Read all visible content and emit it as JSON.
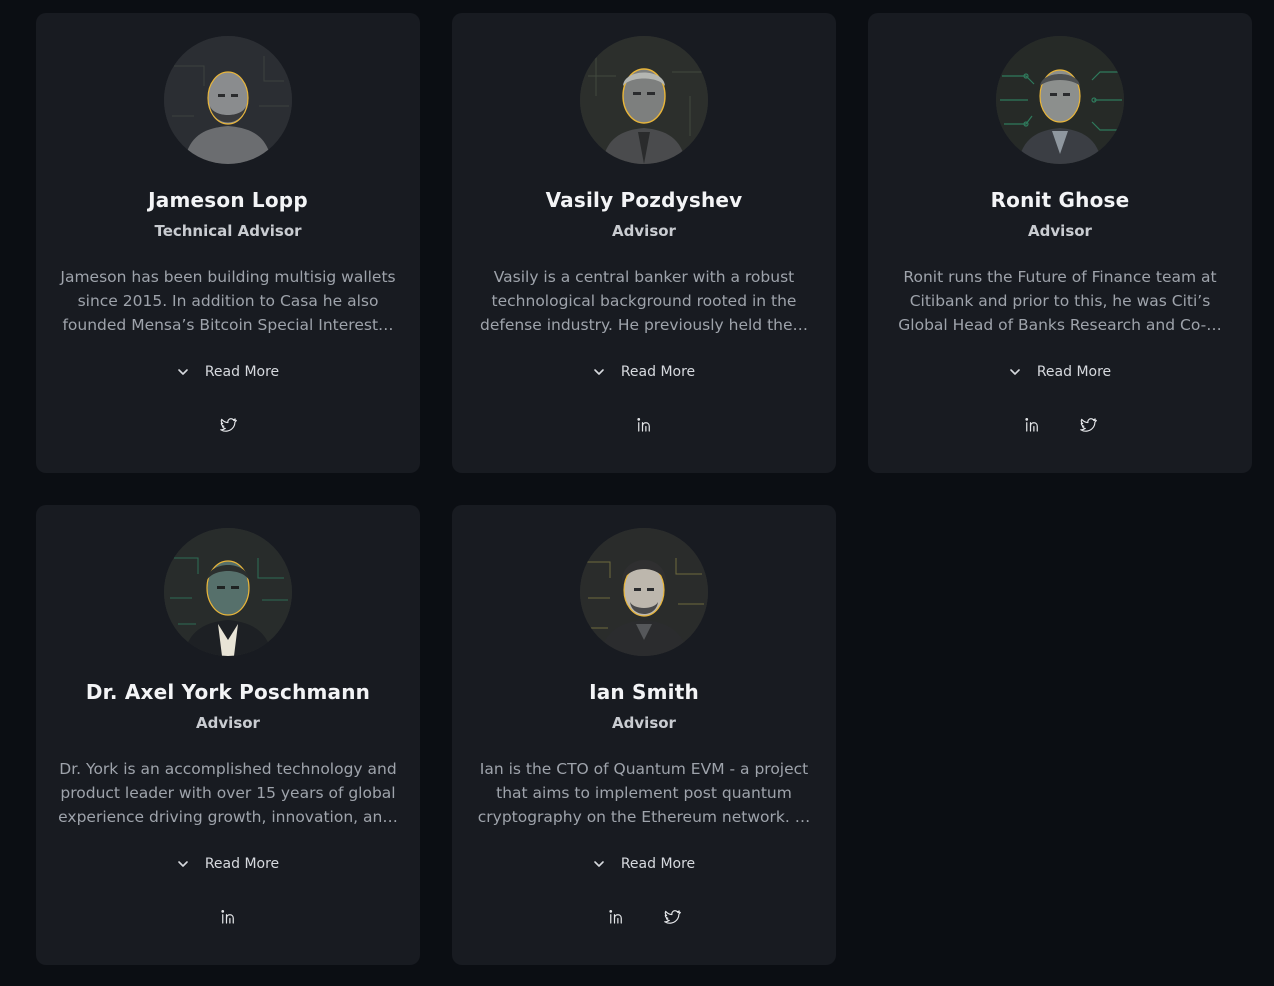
{
  "colors": {
    "page_bg": "#0b0e13",
    "card_bg": "#181b21",
    "accent_outline": "#e8b53a",
    "name_text": "#f3f4f6",
    "bio_text": "#9ea3ab"
  },
  "read_more_label": "Read More",
  "advisors": [
    {
      "name": "Jameson Lopp",
      "role": "Technical Advisor",
      "bio": "Jameson has been building multisig wallets since 2015. In addition to Casa he also founded Mensa’s Bitcoin Special Interest…",
      "socials": [
        "twitter-icon"
      ]
    },
    {
      "name": "Vasily Pozdyshev",
      "role": "Advisor",
      "bio": "Vasily is a central banker with a robust technological background rooted in the defense industry. He previously held the…",
      "socials": [
        "linkedin-icon"
      ]
    },
    {
      "name": "Ronit Ghose",
      "role": "Advisor",
      "bio": "Ronit runs the Future of Finance team at Citibank and prior to this, he was Citi’s Global Head of Banks Research and Co-…",
      "socials": [
        "linkedin-icon",
        "twitter-icon"
      ]
    },
    {
      "name": "Dr. Axel York Poschmann",
      "role": "Advisor",
      "bio": "Dr. York is an accomplished technology and product leader with over 15 years of global experience driving growth, innovation, an…",
      "socials": [
        "linkedin-icon"
      ]
    },
    {
      "name": "Ian Smith",
      "role": "Advisor",
      "bio": "Ian is the CTO of Quantum EVM - a project that aims to implement post quantum cryptography on the Ethereum network. …",
      "socials": [
        "linkedin-icon",
        "twitter-icon"
      ]
    }
  ]
}
